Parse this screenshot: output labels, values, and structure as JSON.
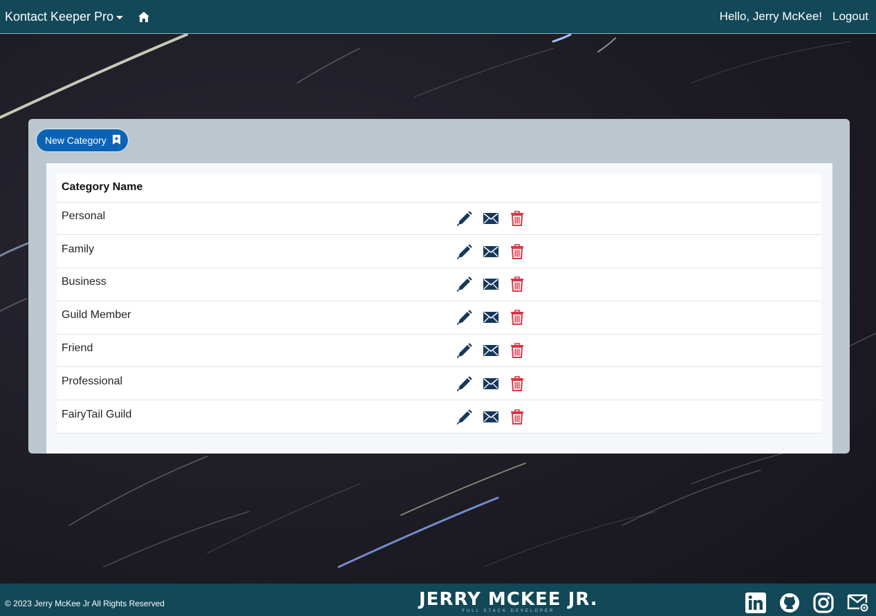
{
  "navbar": {
    "brand": "Kontact Keeper Pro",
    "greeting": "Hello, Jerry McKee!",
    "logout": "Logout"
  },
  "card": {
    "new_button": "New Category",
    "table": {
      "header": "Category Name",
      "rows": [
        {
          "name": "Personal"
        },
        {
          "name": "Family"
        },
        {
          "name": "Business"
        },
        {
          "name": "Guild Member"
        },
        {
          "name": "Friend"
        },
        {
          "name": "Professional"
        },
        {
          "name": "FairyTail Guild"
        }
      ]
    }
  },
  "footer": {
    "copyright": "© 2023 Jerry McKee Jr All Rights Reserved",
    "logo_title": "JERRY MCKEE JR.",
    "logo_subtitle": "FULL STACK DEVELOPER"
  },
  "colors": {
    "navbar": "#124857",
    "primary_button": "#0b63b6",
    "edit_icon": "#17385c",
    "delete_icon": "#dc3545"
  }
}
